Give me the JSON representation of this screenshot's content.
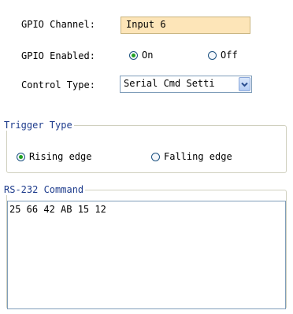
{
  "gpio": {
    "channel_label": "GPIO Channel:",
    "channel_value": "Input 6",
    "enabled_label": "GPIO Enabled:",
    "enabled_on": "On",
    "enabled_off": "Off",
    "enabled_selected": "On",
    "control_label": "Control Type:",
    "control_value": "Serial Cmd Setti",
    "channel_bg": "#fde5b8"
  },
  "trigger": {
    "title": "Trigger Type",
    "rising": "Rising edge",
    "falling": "Falling edge",
    "selected": "Rising edge"
  },
  "rs232": {
    "title": "RS-232 Command",
    "value": "25 66 42 AB 15 12"
  },
  "colors": {
    "group_title": "#1e3c8c",
    "radio_dot": "#21a121"
  }
}
